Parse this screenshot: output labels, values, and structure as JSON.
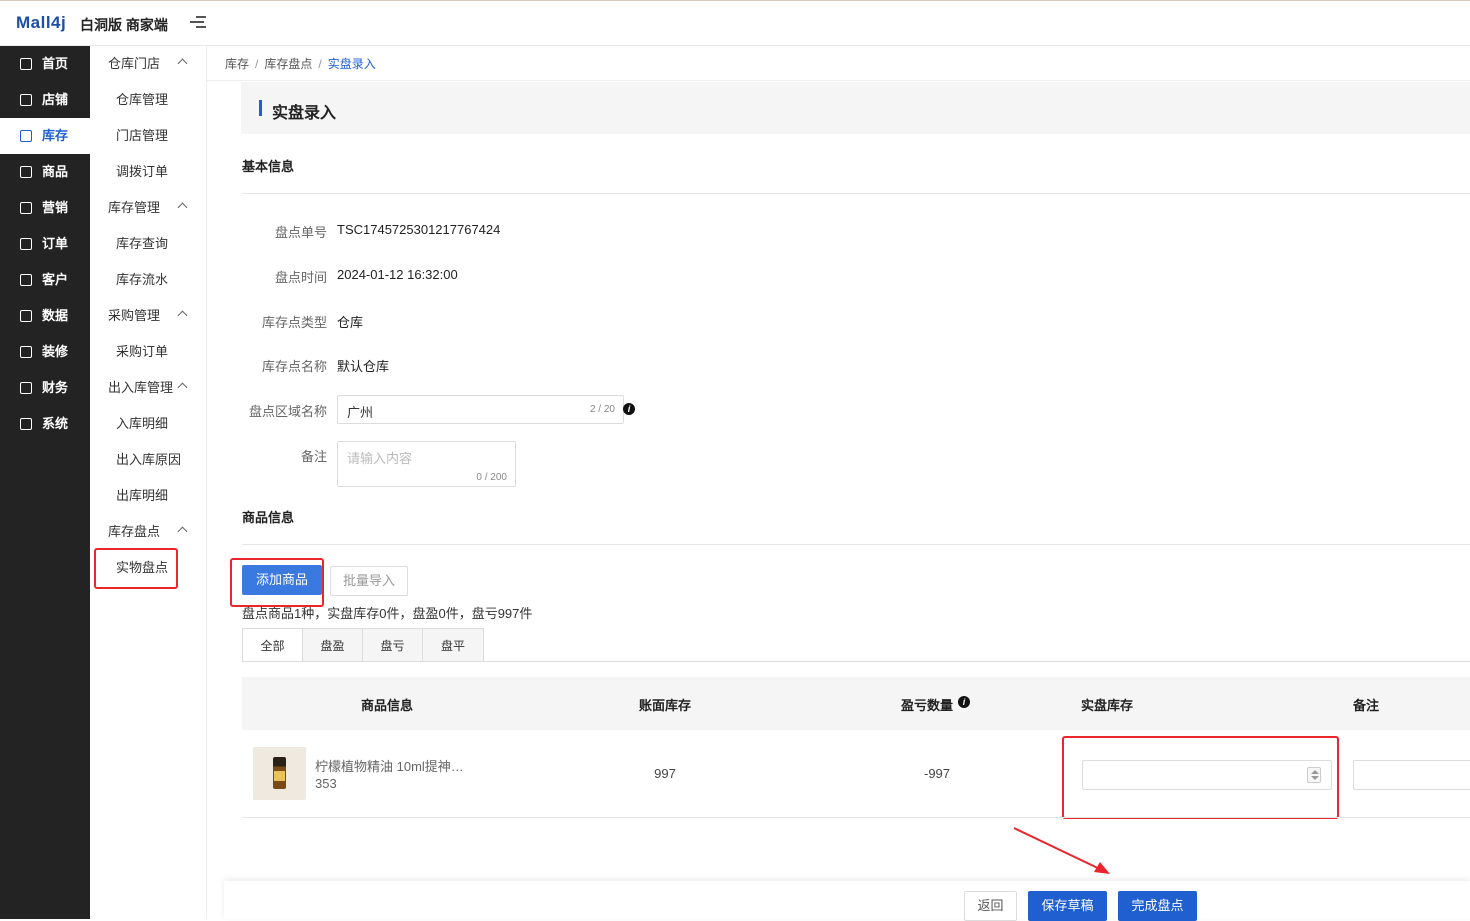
{
  "header": {
    "logo": "Mall4j",
    "brand": "白洞版 商家端"
  },
  "sidebar": {
    "items": [
      {
        "label": "首页",
        "icon": "home-icon",
        "active": false
      },
      {
        "label": "店铺",
        "icon": "shop-icon",
        "active": false
      },
      {
        "label": "库存",
        "icon": "inventory-icon",
        "active": true
      },
      {
        "label": "商品",
        "icon": "goods-icon",
        "active": false
      },
      {
        "label": "营销",
        "icon": "gift-icon",
        "active": false
      },
      {
        "label": "订单",
        "icon": "order-icon",
        "active": false
      },
      {
        "label": "客户",
        "icon": "customer-icon",
        "active": false
      },
      {
        "label": "数据",
        "icon": "chart-icon",
        "active": false
      },
      {
        "label": "装修",
        "icon": "decorate-icon",
        "active": false
      },
      {
        "label": "财务",
        "icon": "finance-icon",
        "active": false
      },
      {
        "label": "系统",
        "icon": "settings-icon",
        "active": false
      }
    ]
  },
  "subnav": {
    "groups": [
      {
        "label": "仓库门店",
        "items": [
          "仓库管理",
          "门店管理",
          "调拨订单"
        ]
      },
      {
        "label": "库存管理",
        "items": [
          "库存查询",
          "库存流水"
        ]
      },
      {
        "label": "采购管理",
        "items": [
          "采购订单"
        ]
      },
      {
        "label": "出入库管理",
        "items": [
          "入库明细",
          "出入库原因",
          "出库明细"
        ]
      },
      {
        "label": "库存盘点",
        "items": [
          "实物盘点"
        ]
      }
    ]
  },
  "breadcrumb": {
    "l1": "库存",
    "l2": "库存盘点",
    "current": "实盘录入"
  },
  "page": {
    "title": "实盘录入"
  },
  "basic_info": {
    "section_title": "基本信息",
    "fields": {
      "order_no_label": "盘点单号",
      "order_no": "TSC1745725301217767424",
      "time_label": "盘点时间",
      "time": "2024-01-12 16:32:00",
      "type_label": "库存点类型",
      "type": "仓库",
      "name_label": "库存点名称",
      "name": "默认仓库",
      "area_label": "盘点区域名称",
      "area_value": "广州",
      "area_count": "2 / 20",
      "remark_label": "备注",
      "remark_placeholder": "请输入内容",
      "remark_count": "0 / 200"
    }
  },
  "goods_info": {
    "section_title": "商品信息",
    "add_button": "添加商品",
    "import_button": "批量导入",
    "summary": "盘点商品1种，实盘库存0件，盘盈0件，盘亏997件",
    "tabs": [
      "全部",
      "盘盈",
      "盘亏",
      "盘平"
    ],
    "columns": {
      "info": "商品信息",
      "book_stock": "账面库存",
      "diff": "盈亏数量",
      "actual": "实盘库存",
      "remark": "备注"
    },
    "rows": [
      {
        "name": "柠檬植物精油 10ml提神…",
        "code": "353",
        "book_stock": "997",
        "diff": "-997",
        "actual": "",
        "remark": ""
      }
    ]
  },
  "footer": {
    "back": "返回",
    "save_draft": "保存草稿",
    "complete": "完成盘点"
  },
  "colors": {
    "primary": "#3a7ae0",
    "sidebar_bg": "#232323",
    "highlight": "#e8262b"
  }
}
